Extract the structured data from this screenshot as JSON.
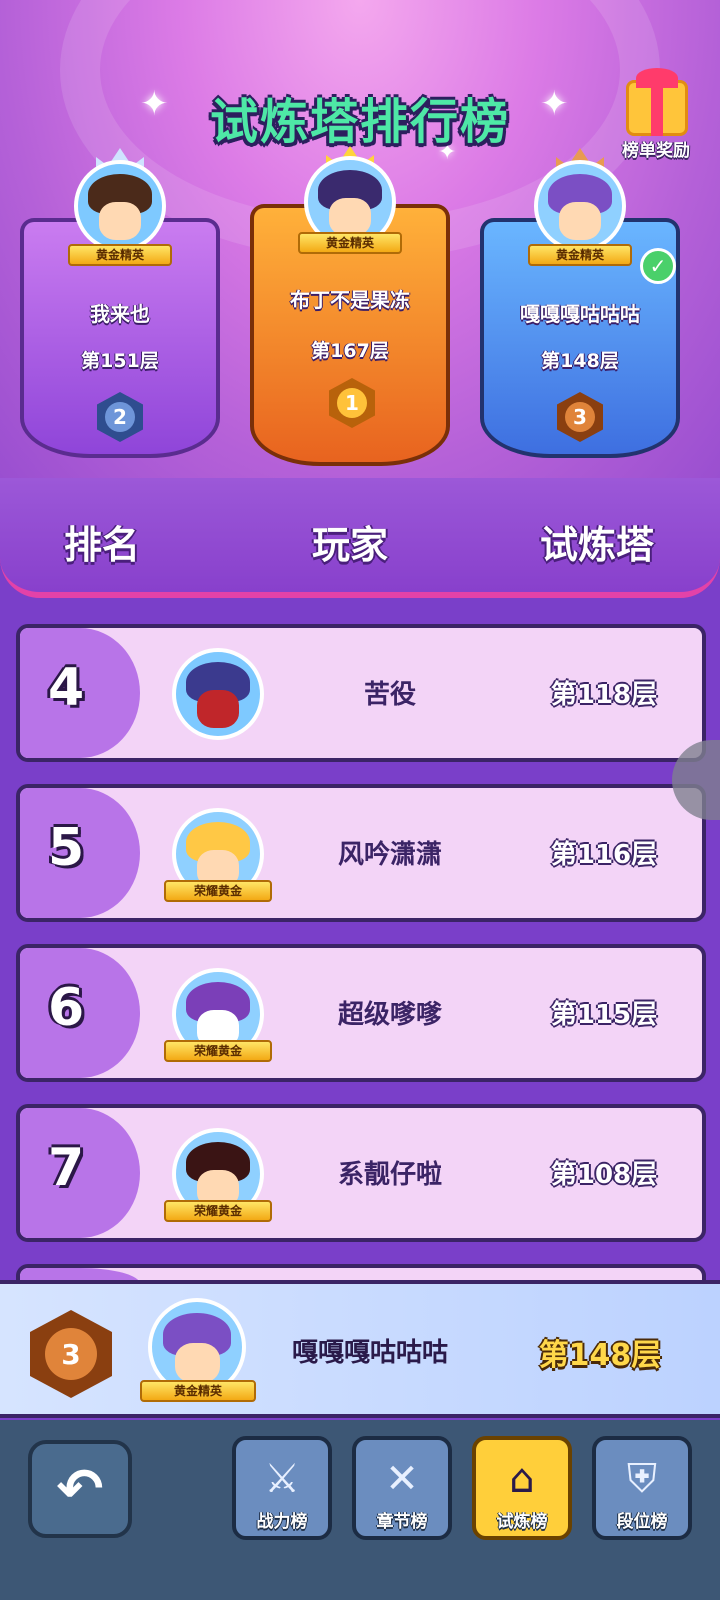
{
  "header": {
    "title": "试炼塔排行榜",
    "reward_label": "榜单奖励"
  },
  "podium": [
    {
      "rank": "2",
      "name": "我来也",
      "floor": "第151层",
      "badge": "黄金精英"
    },
    {
      "rank": "1",
      "name": "布丁不是果冻",
      "floor": "第167层",
      "badge": "黄金精英"
    },
    {
      "rank": "3",
      "name": "嘎嘎嘎咕咕咕",
      "floor": "第148层",
      "badge": "黄金精英"
    }
  ],
  "columns": {
    "rank": "排名",
    "player": "玩家",
    "tower": "试炼塔"
  },
  "rows": [
    {
      "rank": "4",
      "name": "苦役",
      "floor": "第118层",
      "badge": ""
    },
    {
      "rank": "5",
      "name": "风吟潇潇",
      "floor": "第116层",
      "badge": "荣耀黄金"
    },
    {
      "rank": "6",
      "name": "超级嗲嗲",
      "floor": "第115层",
      "badge": "荣耀黄金"
    },
    {
      "rank": "7",
      "name": "系靓仔啦",
      "floor": "第108层",
      "badge": "荣耀黄金"
    }
  ],
  "me": {
    "rank": "3",
    "name": "嘎嘎嘎咕咕咕",
    "floor": "第148层",
    "badge": "黄金精英"
  },
  "nav": {
    "back_icon": "↶",
    "tabs": [
      {
        "label": "战力榜",
        "icon": "crossed-swords-icon"
      },
      {
        "label": "章节榜",
        "icon": "map-scroll-icon"
      },
      {
        "label": "试炼榜",
        "icon": "tower-door-icon"
      },
      {
        "label": "段位榜",
        "icon": "shield-icon"
      }
    ]
  },
  "colors": {
    "accent_pink": "#e342a8",
    "gold": "#ffcf3a",
    "purple": "#7a3fc9"
  }
}
